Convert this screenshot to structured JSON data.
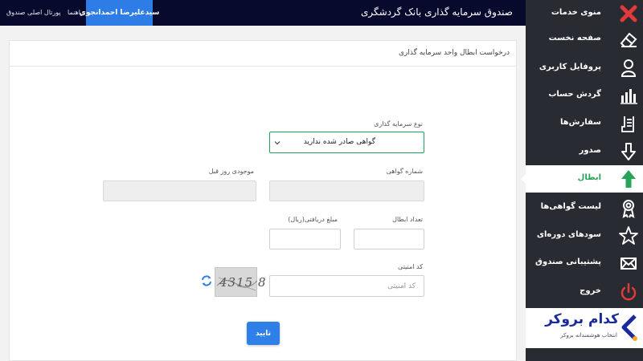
{
  "header": {
    "site_title": "صندوق سرمایه گذاری بانک گردشگری",
    "user_name": "سیدعلیرضا احمدانجوی",
    "help_link": "راهنما",
    "portal_link": "پورتال اصلی صندوق"
  },
  "sidebar": {
    "items": [
      {
        "label": "منوی خدمات",
        "icon": "close-icon"
      },
      {
        "label": "صفحه نخست",
        "icon": "eraser-icon"
      },
      {
        "label": "پروفایل کاربری",
        "icon": "user-icon"
      },
      {
        "label": "گردش حساب",
        "icon": "bar-chart-icon"
      },
      {
        "label": "سفارش‌ها",
        "icon": "clipboard-icon"
      },
      {
        "label": "صدور",
        "icon": "arrow-down-icon"
      },
      {
        "label": "ابطال",
        "icon": "arrow-up-icon"
      },
      {
        "label": "لیست گواهی‌ها",
        "icon": "ribbon-icon"
      },
      {
        "label": "سودهای دوره‌ای",
        "icon": "star-icon"
      },
      {
        "label": "پشتیبانی صندوق",
        "icon": "envelope-icon"
      },
      {
        "label": "خروج",
        "icon": "power-icon"
      }
    ],
    "active_index": 6,
    "colors": {
      "background": "#282b32",
      "close": "#e03a3a",
      "active": "#27a35a",
      "logout": "#e03a3a"
    }
  },
  "logo": {
    "title": "کدام بروکر",
    "subtitle": "انتخاب هوشمندانه بروکر"
  },
  "form": {
    "title": "درخواست ابطال واحد سرمایه گذاری",
    "investment_type": {
      "label": "نوع سرمایه گذاری",
      "value": "گواهی صادر شده ندارید"
    },
    "certificate_number": {
      "label": "شماره گواهی",
      "value": ""
    },
    "previous_day_balance": {
      "label": "موجودی روز قبل",
      "value": ""
    },
    "cancel_count": {
      "label": "تعداد ابطال",
      "value": ""
    },
    "received_amount": {
      "label": "مبلغ دریافتی(ریال)",
      "value": ""
    },
    "security_code": {
      "label": "کد امنیتی",
      "placeholder": "کد امنیتی",
      "captcha_text": "4315 8"
    },
    "submit_label": "تایید"
  },
  "colors": {
    "topbar": "#070a2c",
    "accent": "#2e7ce6",
    "select_border": "#1ea35a"
  }
}
